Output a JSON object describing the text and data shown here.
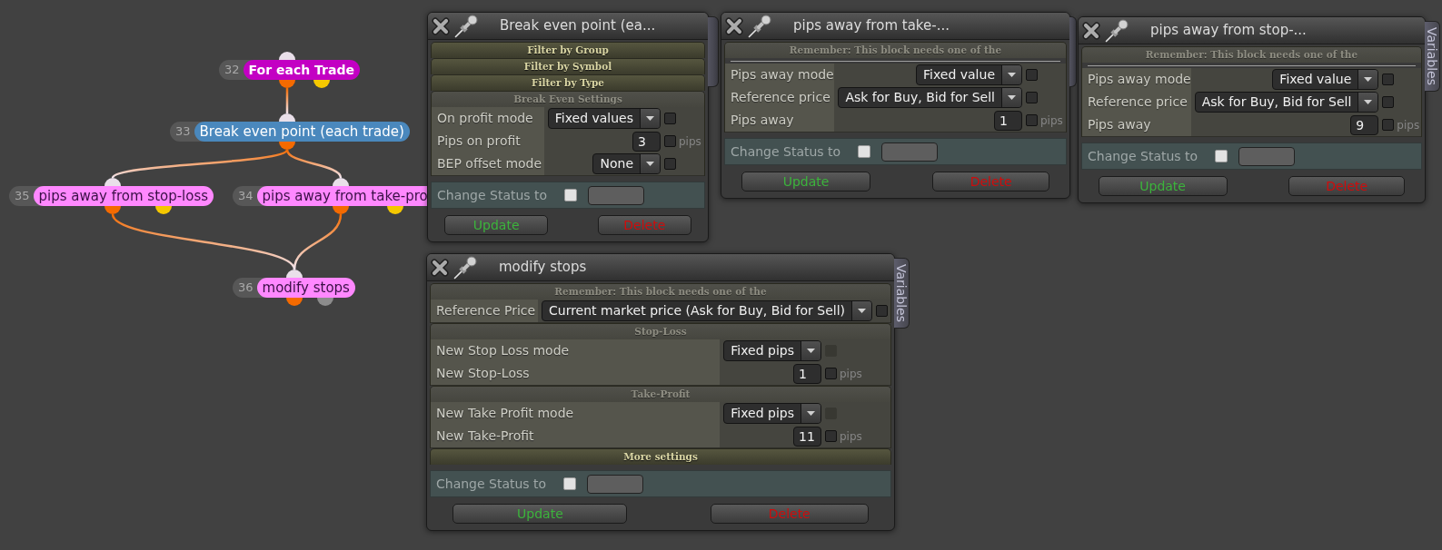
{
  "canvas": {
    "nodes": [
      {
        "number": "32",
        "label": "For each Trade",
        "kind": "loop",
        "color": "#c300c3",
        "ports": [
          {
            "kind": "in",
            "color": "#e9dfe9"
          },
          {
            "kind": "out",
            "color": "#f46a00"
          },
          {
            "kind": "aux",
            "color": "#f5c800"
          }
        ]
      },
      {
        "number": "33",
        "label": "Break even point (each trade)",
        "kind": "action",
        "color": "#4a88bd",
        "ports": [
          {
            "kind": "in",
            "color": "#e9dfe9"
          },
          {
            "kind": "out",
            "color": "#f46a00"
          }
        ]
      },
      {
        "number": "35",
        "label": "pips away from stop-loss",
        "kind": "action",
        "color": "#ff88ff",
        "ports": [
          {
            "kind": "in",
            "color": "#e9dfe9"
          },
          {
            "kind": "out",
            "color": "#f46a00"
          },
          {
            "kind": "aux",
            "color": "#f5c800"
          }
        ]
      },
      {
        "number": "34",
        "label": "pips away from take-pro",
        "kind": "action",
        "color": "#ff88ff",
        "ports": [
          {
            "kind": "in",
            "color": "#e9dfe9"
          },
          {
            "kind": "out",
            "color": "#f46a00"
          },
          {
            "kind": "aux",
            "color": "#f5c800"
          }
        ]
      },
      {
        "number": "36",
        "label": "modify stops",
        "kind": "action",
        "color": "#ff88ff",
        "ports": [
          {
            "kind": "in",
            "color": "#e9dfe9"
          },
          {
            "kind": "out",
            "color": "#f46a00"
          },
          {
            "kind": "aux",
            "color": "#8c8c8c"
          }
        ]
      }
    ]
  },
  "windows": [
    {
      "title": "Break even point (ea...",
      "side_tab": {
        "covered": true
      },
      "groups": [
        {
          "label": "Filter by Group",
          "expanded": false
        },
        {
          "label": "Filter by Symbol",
          "expanded": false
        },
        {
          "label": "Filter by Type",
          "expanded": false
        },
        {
          "label": "Break Even Settings",
          "expanded": true,
          "rows": [
            {
              "label": "On profit mode",
              "kind": "select",
              "value": "Fixed values",
              "checked": false,
              "disabled": false
            },
            {
              "label": "Pips on profit",
              "kind": "number",
              "value": "3",
              "unit": "pips",
              "checked": false,
              "disabled": false
            },
            {
              "label": "BEP offset mode",
              "kind": "select",
              "value": "None",
              "checked": false,
              "disabled": false
            }
          ]
        }
      ],
      "status": {
        "label": "Change Status to",
        "checked": false
      },
      "buttons": [
        {
          "label": "Update",
          "kind": "update"
        },
        {
          "label": "Delete",
          "kind": "delete"
        }
      ]
    },
    {
      "title": "pips away from take-...",
      "side_tab": {
        "covered": true
      },
      "groups": [
        {
          "label": "Remember: This block needs one of the",
          "expanded": true,
          "divider": true,
          "rows": [
            {
              "label": "Pips away mode",
              "kind": "select",
              "value": "Fixed value",
              "checked": false,
              "disabled": false
            },
            {
              "label": "Reference price",
              "kind": "select",
              "value": "Ask for Buy, Bid for Sell",
              "checked": false,
              "disabled": false
            },
            {
              "label": "Pips away",
              "kind": "number",
              "value": "1",
              "unit": "pips",
              "checked": false,
              "disabled": false
            }
          ]
        }
      ],
      "status": {
        "label": "Change Status to",
        "checked": false
      },
      "buttons": [
        {
          "label": "Update",
          "kind": "update"
        },
        {
          "label": "Delete",
          "kind": "delete"
        }
      ]
    },
    {
      "title": "pips away from stop-...",
      "side_tab": {
        "label": "Variables",
        "covered": false
      },
      "groups": [
        {
          "label": "Remember: This block needs one of the",
          "expanded": true,
          "divider": true,
          "rows": [
            {
              "label": "Pips away mode",
              "kind": "select",
              "value": "Fixed value",
              "checked": false,
              "disabled": false
            },
            {
              "label": "Reference price",
              "kind": "select",
              "value": "Ask for Buy, Bid for Sell",
              "checked": false,
              "disabled": false
            },
            {
              "label": "Pips away",
              "kind": "number",
              "value": "9",
              "unit": "pips",
              "checked": false,
              "disabled": false
            }
          ]
        }
      ],
      "status": {
        "label": "Change Status to",
        "checked": false
      },
      "buttons": [
        {
          "label": "Update",
          "kind": "update"
        },
        {
          "label": "Delete",
          "kind": "delete"
        }
      ]
    },
    {
      "title": "modify stops",
      "side_tab": {
        "label": "Variables",
        "covered": false
      },
      "groups": [
        {
          "label": "Remember: This block needs one of the",
          "expanded": true,
          "rows": [
            {
              "label": "Reference Price",
              "kind": "select",
              "value": "Current market price (Ask for Buy, Bid for Sell)",
              "checked": false,
              "disabled": false
            }
          ]
        },
        {
          "label": "Stop-Loss",
          "expanded": true,
          "rows": [
            {
              "label": "New Stop Loss mode",
              "kind": "select",
              "value": "Fixed pips",
              "checked": false,
              "disabled": true
            },
            {
              "label": "New Stop-Loss",
              "kind": "number",
              "value": "1",
              "unit": "pips",
              "checked": false,
              "disabled": false
            }
          ]
        },
        {
          "label": "Take-Profit",
          "expanded": true,
          "rows": [
            {
              "label": "New Take Profit mode",
              "kind": "select",
              "value": "Fixed pips",
              "checked": false,
              "disabled": true
            },
            {
              "label": "New Take-Profit",
              "kind": "number",
              "value": "11",
              "unit": "pips",
              "checked": false,
              "disabled": false
            }
          ]
        },
        {
          "label": "More settings",
          "expanded": false
        }
      ],
      "status": {
        "label": "Change Status to",
        "checked": false
      },
      "buttons": [
        {
          "label": "Update",
          "kind": "update"
        },
        {
          "label": "Delete",
          "kind": "delete"
        }
      ]
    }
  ]
}
